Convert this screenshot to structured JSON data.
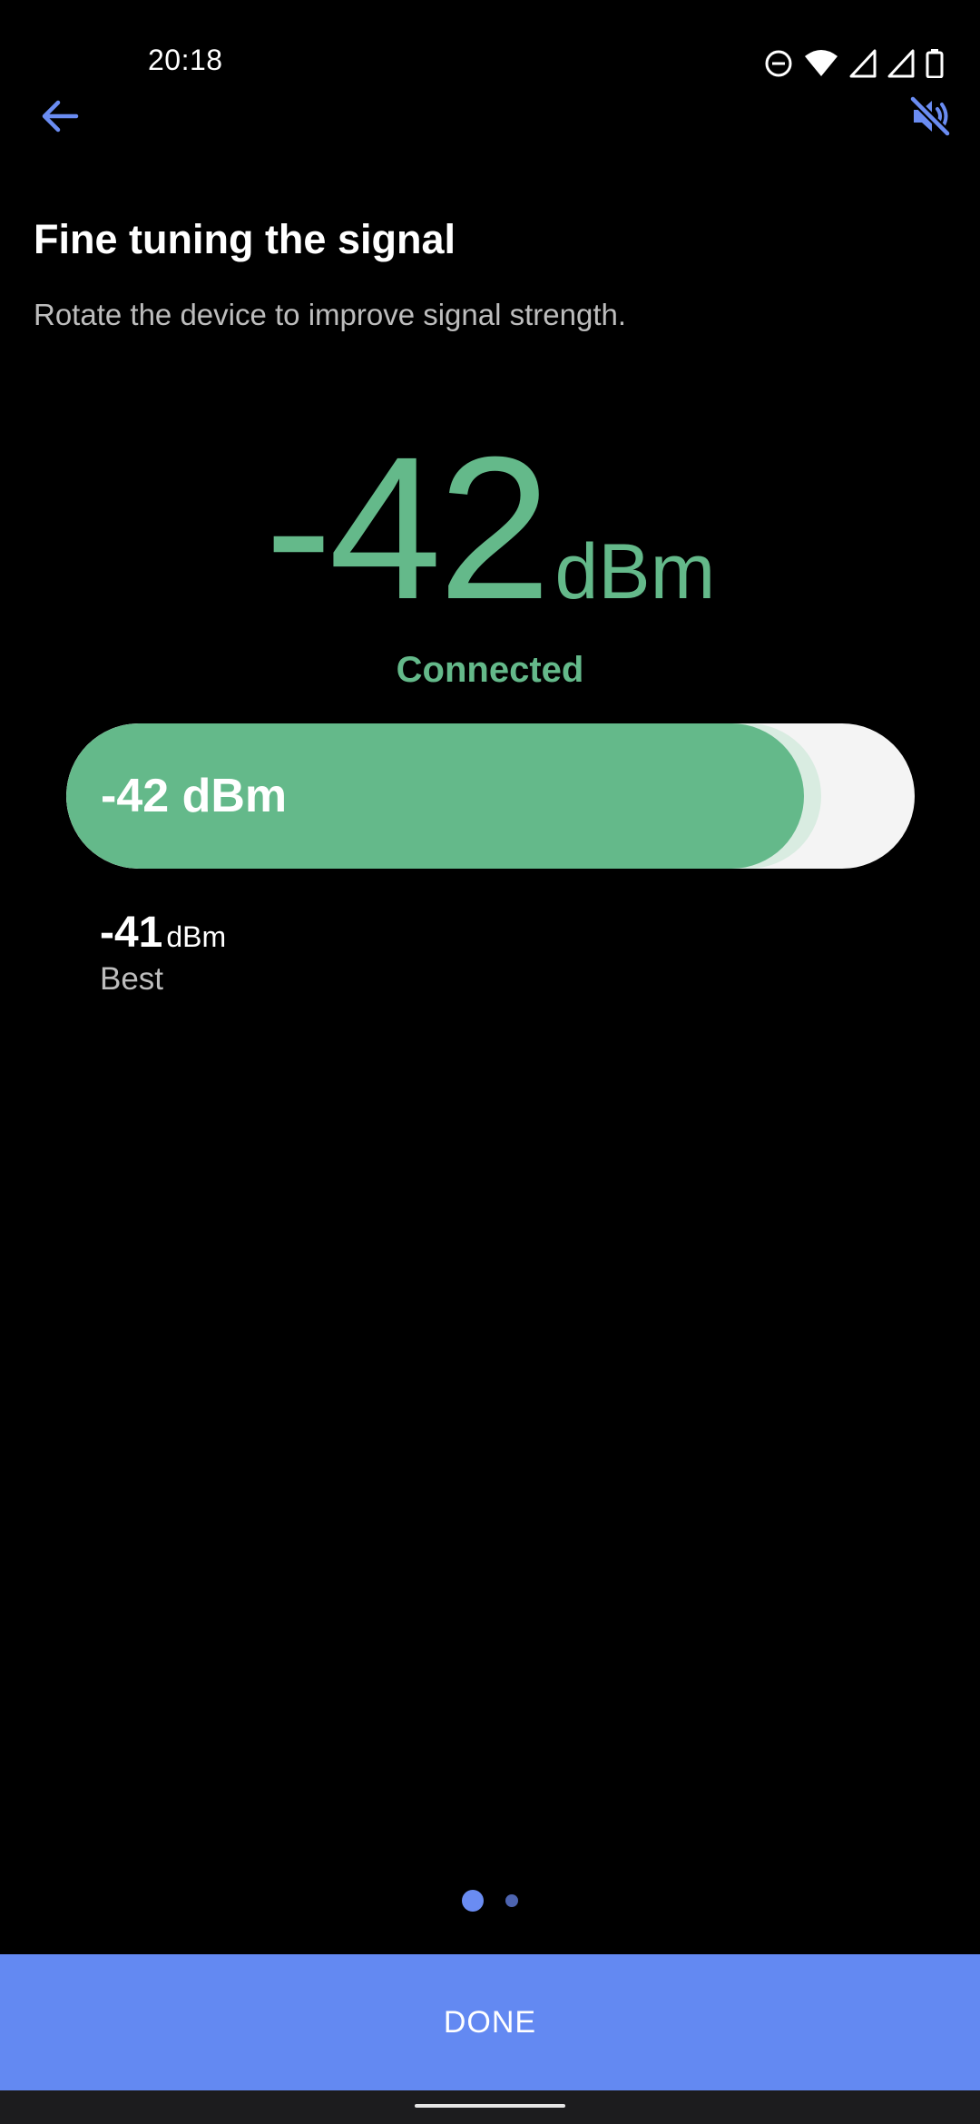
{
  "status_bar": {
    "time": "20:18",
    "icons": [
      "do-not-disturb-icon",
      "wifi-icon",
      "cellular-signal-icon",
      "cellular-signal-icon",
      "battery-icon"
    ]
  },
  "app_bar": {
    "back_icon": "arrow-left-icon",
    "mute_icon": "volume-off-icon"
  },
  "header": {
    "title": "Fine tuning the signal",
    "subtitle": "Rotate the device to improve signal strength."
  },
  "reading": {
    "value": "-42",
    "unit": "dBm",
    "status": "Connected"
  },
  "signal_bar": {
    "label": "-42 dBm",
    "fill_fraction": 0.87
  },
  "best": {
    "value": "-41",
    "unit": "dBm",
    "label": "Best"
  },
  "pager": {
    "current_page": 1,
    "total_pages": 2
  },
  "footer": {
    "done_label": "DONE"
  },
  "colors": {
    "accent_blue": "#6389f2",
    "signal_green": "#64b98a",
    "track": "#f4f4f4"
  }
}
